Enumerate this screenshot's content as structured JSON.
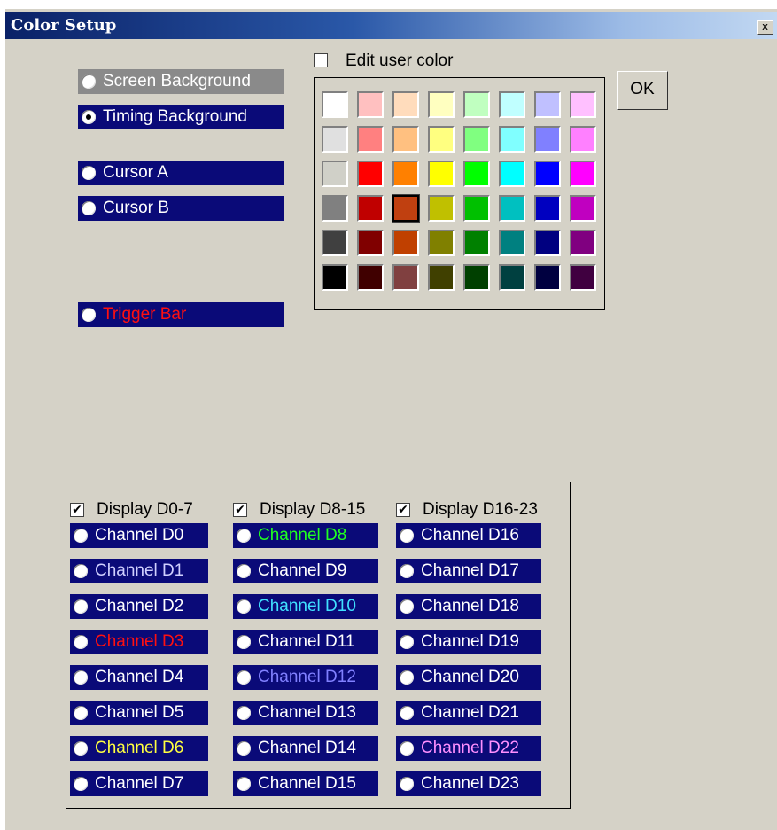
{
  "window": {
    "title": "Color Setup",
    "close_label": "x"
  },
  "targets": [
    {
      "label": "Screen Background",
      "checked": false,
      "style": "gray",
      "color": "#ffffff"
    },
    {
      "label": "Timing Background",
      "checked": true,
      "style": "blue",
      "color": "#ffffff"
    },
    {
      "label": "Cursor A",
      "checked": false,
      "style": "blue",
      "color": "#ffffff"
    },
    {
      "label": "Cursor B",
      "checked": false,
      "style": "blue",
      "color": "#ffffff"
    },
    {
      "label": "Trigger Bar",
      "checked": false,
      "style": "blue",
      "color": "#ff1010"
    }
  ],
  "edit_user_color": {
    "label": "Edit user color",
    "checked": false
  },
  "ok_label": "OK",
  "palette": {
    "selected": [
      3,
      2
    ],
    "rows": [
      [
        "#ffffff",
        "#ffc0c0",
        "#ffdcbc",
        "#ffffc0",
        "#c0ffc0",
        "#c0ffff",
        "#c0c0ff",
        "#ffc0ff"
      ],
      [
        "#e0e0e0",
        "#ff8080",
        "#ffc080",
        "#ffff80",
        "#80ff80",
        "#80ffff",
        "#8080ff",
        "#ff80ff"
      ],
      [
        "#d0d0c8",
        "#ff0000",
        "#ff8000",
        "#ffff00",
        "#00ff00",
        "#00ffff",
        "#0000ff",
        "#ff00ff"
      ],
      [
        "#808080",
        "#c00000",
        "#c04010",
        "#c0c000",
        "#00c000",
        "#00c0c0",
        "#0000c0",
        "#c000c0"
      ],
      [
        "#404040",
        "#800000",
        "#c04000",
        "#808000",
        "#008000",
        "#008080",
        "#000080",
        "#800080"
      ],
      [
        "#000000",
        "#400000",
        "#804040",
        "#404000",
        "#004000",
        "#004040",
        "#000040",
        "#400040"
      ]
    ]
  },
  "channel_groups": [
    {
      "display_label": "Display D0-7",
      "display_checked": true,
      "channels": [
        {
          "label": "Channel D0",
          "color": "#ffffff"
        },
        {
          "label": "Channel D1",
          "color": "#d0d0ff"
        },
        {
          "label": "Channel D2",
          "color": "#ffffff"
        },
        {
          "label": "Channel D3",
          "color": "#ff1010"
        },
        {
          "label": "Channel D4",
          "color": "#ffffff"
        },
        {
          "label": "Channel D5",
          "color": "#ffffff"
        },
        {
          "label": "Channel D6",
          "color": "#ffff40"
        },
        {
          "label": "Channel D7",
          "color": "#ffffff"
        }
      ]
    },
    {
      "display_label": "Display D8-15",
      "display_checked": true,
      "channels": [
        {
          "label": "Channel D8",
          "color": "#20ff20"
        },
        {
          "label": "Channel D9",
          "color": "#ffffff"
        },
        {
          "label": "Channel D10",
          "color": "#40e0ff"
        },
        {
          "label": "Channel D11",
          "color": "#ffffff"
        },
        {
          "label": "Channel D12",
          "color": "#8080ff"
        },
        {
          "label": "Channel D13",
          "color": "#ffffff"
        },
        {
          "label": "Channel D14",
          "color": "#ffffff"
        },
        {
          "label": "Channel D15",
          "color": "#ffffff"
        }
      ]
    },
    {
      "display_label": "Display D16-23",
      "display_checked": true,
      "channels": [
        {
          "label": "Channel D16",
          "color": "#ffffff"
        },
        {
          "label": "Channel D17",
          "color": "#ffffff"
        },
        {
          "label": "Channel D18",
          "color": "#ffffff"
        },
        {
          "label": "Channel D19",
          "color": "#ffffff"
        },
        {
          "label": "Channel D20",
          "color": "#ffffff"
        },
        {
          "label": "Channel D21",
          "color": "#ffffff"
        },
        {
          "label": "Channel D22",
          "color": "#ff90ff"
        },
        {
          "label": "Channel D23",
          "color": "#ffffff"
        }
      ]
    }
  ]
}
